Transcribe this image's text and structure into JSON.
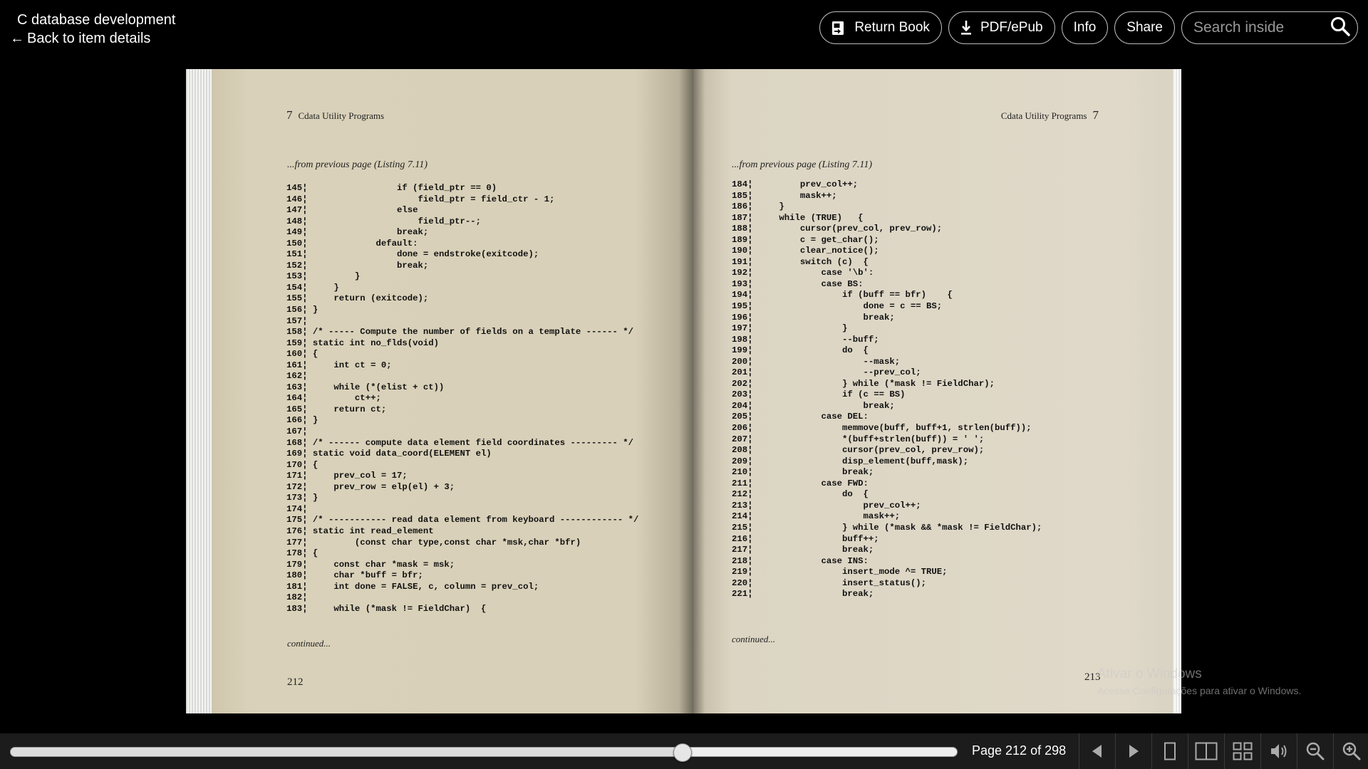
{
  "header": {
    "book_title": "C database development",
    "back_label": "Back to item details",
    "back_arrow": "←"
  },
  "toolbar": {
    "return_label": "Return Book",
    "return_icon": "return-book-icon",
    "download_label": "PDF/ePub",
    "download_icon": "download-icon",
    "info_label": "Info",
    "share_label": "Share",
    "search_placeholder": "Search inside",
    "search_icon": "search-icon"
  },
  "left_page": {
    "chapter_num": "7",
    "running_head": "Cdata Utility Programs",
    "from_previous": "...from previous page (Listing 7.11)",
    "code": [
      "145¦                 if (field_ptr == 0)",
      "146¦                     field_ptr = field_ctr - 1;",
      "147¦                 else",
      "148¦                     field_ptr--;",
      "149¦                 break;",
      "150¦             default:",
      "151¦                 done = endstroke(exitcode);",
      "152¦                 break;",
      "153¦         }",
      "154¦     }",
      "155¦     return (exitcode);",
      "156¦ }",
      "157¦",
      "158¦ /* ----- Compute the number of fields on a template ------ */",
      "159¦ static int no_flds(void)",
      "160¦ {",
      "161¦     int ct = 0;",
      "162¦",
      "163¦     while (*(elist + ct))",
      "164¦         ct++;",
      "165¦     return ct;",
      "166¦ }",
      "167¦",
      "168¦ /* ------ compute data element field coordinates --------- */",
      "169¦ static void data_coord(ELEMENT el)",
      "170¦ {",
      "171¦     prev_col = 17;",
      "172¦     prev_row = elp(el) + 3;",
      "173¦ }",
      "174¦",
      "175¦ /* ----------- read data element from keyboard ------------ */",
      "176¦ static int read_element",
      "177¦         (const char type,const char *msk,char *bfr)",
      "178¦ {",
      "179¦     const char *mask = msk;",
      "180¦     char *buff = bfr;",
      "181¦     int done = FALSE, c, column = prev_col;",
      "182¦",
      "183¦     while (*mask != FieldChar)  {"
    ],
    "continued": "continued...",
    "folio": "212"
  },
  "right_page": {
    "chapter_num": "7",
    "running_head": "Cdata Utility Programs",
    "from_previous": "...from previous page (Listing 7.11)",
    "code": [
      "184¦         prev_col++;",
      "185¦         mask++;",
      "186¦     }",
      "187¦     while (TRUE)   {",
      "188¦         cursor(prev_col, prev_row);",
      "189¦         c = get_char();",
      "190¦         clear_notice();",
      "191¦         switch (c)  {",
      "192¦             case '\\b':",
      "193¦             case BS:",
      "194¦                 if (buff == bfr)    {",
      "195¦                     done = c == BS;",
      "196¦                     break;",
      "197¦                 }",
      "198¦                 --buff;",
      "199¦                 do  {",
      "200¦                     --mask;",
      "201¦                     --prev_col;",
      "202¦                 } while (*mask != FieldChar);",
      "203¦                 if (c == BS)",
      "204¦                     break;",
      "205¦             case DEL:",
      "206¦                 memmove(buff, buff+1, strlen(buff));",
      "207¦                 *(buff+strlen(buff)) = ' ';",
      "208¦                 cursor(prev_col, prev_row);",
      "209¦                 disp_element(buff,mask);",
      "210¦                 break;",
      "211¦             case FWD:",
      "212¦                 do  {",
      "213¦                     prev_col++;",
      "214¦                     mask++;",
      "215¦                 } while (*mask && *mask != FieldChar);",
      "216¦                 buff++;",
      "217¦                 break;",
      "218¦             case INS:",
      "219¦                 insert_mode ^= TRUE;",
      "220¦                 insert_status();",
      "221¦                 break;"
    ],
    "continued": "continued...",
    "folio": "213"
  },
  "watermark": {
    "title": "Ativar o Windows",
    "subtitle": "Acesse Configurações para ativar o Windows."
  },
  "bottombar": {
    "page_indicator": "Page 212 of 298",
    "progress": 0.71,
    "buttons": [
      "prev-page-icon",
      "next-page-icon",
      "one-page-view-icon",
      "two-page-view-icon",
      "thumbnail-view-icon",
      "read-aloud-icon",
      "zoom-out-icon",
      "zoom-in-icon"
    ]
  }
}
